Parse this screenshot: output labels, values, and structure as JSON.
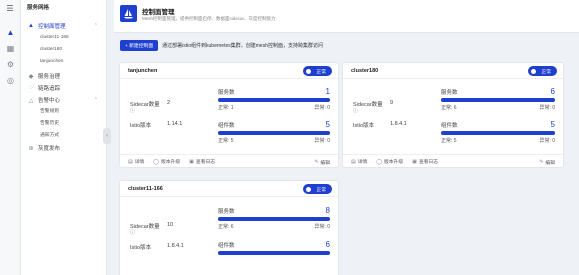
{
  "rail": {
    "icons": [
      "menu-icon",
      "layers-icon",
      "grid-icon",
      "settings-icon",
      "target-icon"
    ]
  },
  "menu": {
    "title": "服务网格",
    "control_plane": "控制面管理",
    "clusters": [
      "cluster11-166",
      "cluster180",
      "tanjunchen"
    ],
    "service_governance": "服务治理",
    "link_tracing": "链路追踪",
    "alert_center": "告警中心",
    "alert_subs": [
      "告警规则",
      "告警历史",
      "通知方式"
    ],
    "canary_release": "灰度发布"
  },
  "header": {
    "title": "控制面管理",
    "subtitle": "Mesh控制面管理，提供控制面启停、数据面sidecar、灰度控制能力"
  },
  "toolbar": {
    "add_button": "+ 新建控制面",
    "description": "通过部署istio组件到kubernetes集群，创建mesh控制面，支持跨集群访问"
  },
  "labels": {
    "status_normal": "正常",
    "sidecar_count": "Sidecar数量",
    "istio_version": "Istio版本",
    "service_count": "服务数",
    "component_count": "组件数",
    "normal_prefix": "正常:",
    "abnormal_prefix": "异常:",
    "action_detail": "详情",
    "action_upgrade": "版本升级",
    "action_logs": "查看日志",
    "action_edit": "编辑"
  },
  "cards": [
    {
      "name": "tanjunchen",
      "sidecar": "2",
      "istio": "1.14.1",
      "services": {
        "total": "1",
        "normal": "1",
        "abnormal": "0",
        "ratio": 1.0
      },
      "components": {
        "total": "5",
        "normal": "5",
        "abnormal": "0",
        "ratio": 1.0
      }
    },
    {
      "name": "cluster180",
      "sidecar": "9",
      "istio": "1.8.4.1",
      "services": {
        "total": "6",
        "normal": "6",
        "abnormal": "0",
        "ratio": 1.0
      },
      "components": {
        "total": "5",
        "normal": "5",
        "abnormal": "0",
        "ratio": 1.0
      }
    },
    {
      "name": "cluster11-166",
      "sidecar": "10",
      "istio": "1.8.4.1",
      "services": {
        "total": "8",
        "normal": "6",
        "abnormal": "0",
        "ratio": 1.0
      },
      "components": {
        "total": "6",
        "normal": "",
        "abnormal": "",
        "ratio": 1.0
      }
    }
  ]
}
